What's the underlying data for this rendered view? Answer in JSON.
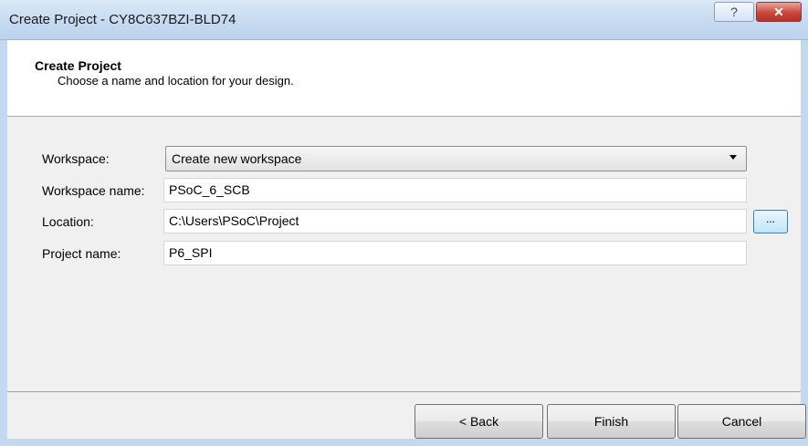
{
  "window": {
    "title": "Create Project - CY8C637BZI-BLD74",
    "help_label": "?",
    "close_label": "✕"
  },
  "header": {
    "title": "Create Project",
    "subtitle": "Choose a name and location for your design."
  },
  "form": {
    "workspace_label": "Workspace:",
    "workspace_value": "Create new workspace",
    "workspace_name_label": "Workspace name:",
    "workspace_name_value": "PSoC_6_SCB",
    "location_label": "Location:",
    "location_value": "C:\\Users\\PSoC\\Project",
    "browse_label": "...",
    "project_name_label": "Project name:",
    "project_name_value": "P6_SPI"
  },
  "footer": {
    "back_label": "< Back",
    "finish_label": "Finish",
    "cancel_label": "Cancel"
  }
}
